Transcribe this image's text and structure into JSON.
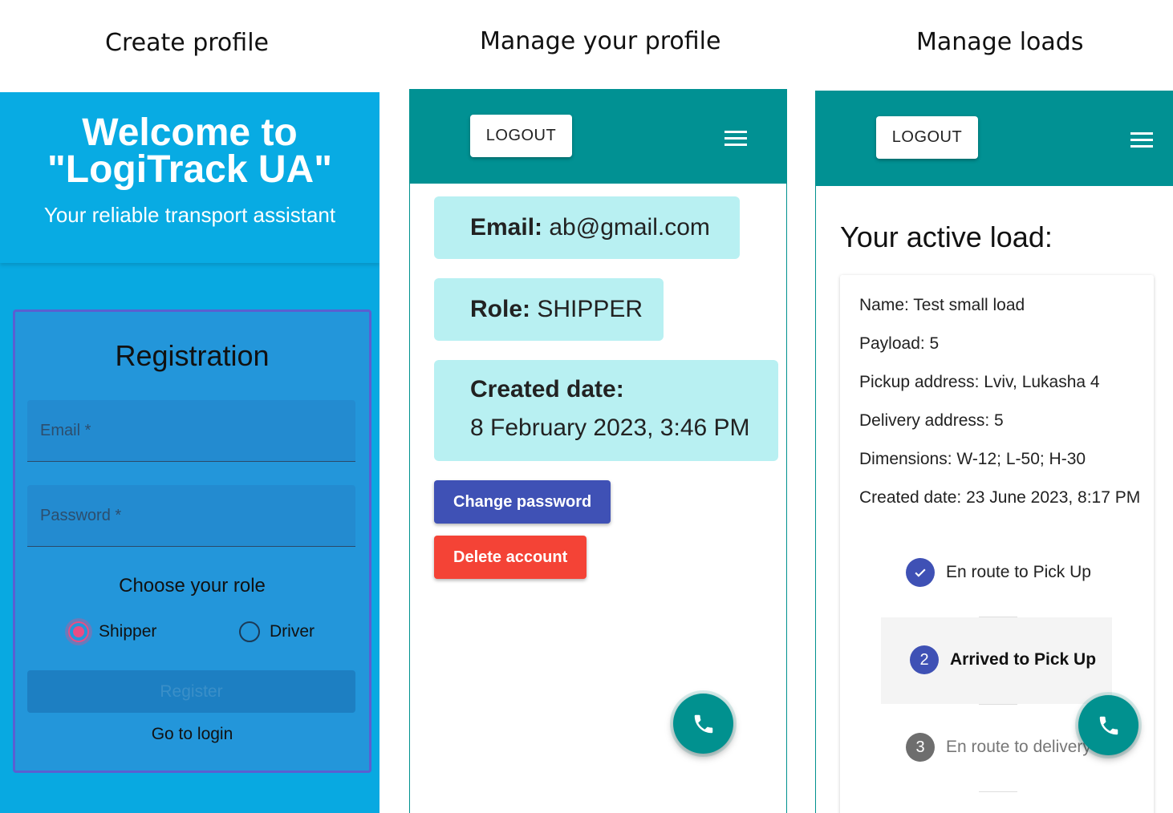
{
  "captions": {
    "create": "Create profile",
    "manage": "Manage your profile",
    "loads": "Manage loads"
  },
  "register_screen": {
    "welcome_line1": "Welcome to",
    "welcome_line2": "\"LogiTrack UA\"",
    "subtitle": "Your reliable transport assistant",
    "form_title": "Registration",
    "email_placeholder": "Email *",
    "password_placeholder": "Password *",
    "role_title": "Choose your role",
    "roles": [
      {
        "label": "Shipper",
        "selected": true
      },
      {
        "label": "Driver",
        "selected": false
      }
    ],
    "register_button": "Register",
    "login_link": "Go to login"
  },
  "profile_screen": {
    "logout": "LOGOUT",
    "email_label": "Email:",
    "email_value": "ab@gmail.com",
    "role_label": "Role:",
    "role_value": "SHIPPER",
    "created_label": "Created date:",
    "created_value": "8 February 2023, 3:46 PM",
    "change_password": "Change password",
    "delete_account": "Delete account"
  },
  "loads_screen": {
    "logout": "LOGOUT",
    "title": "Your active load:",
    "rows": [
      "Name: Test small load",
      "Payload: 5",
      "Pickup address: Lviv, Lukasha 4",
      "Delivery address: 5",
      "Dimensions: W-12; L-50; H-30",
      "Created date: 23 June 2023, 8:17 PM"
    ],
    "steps": [
      {
        "label": "En route to Pick Up",
        "status": "done",
        "num": ""
      },
      {
        "label": "Arrived to Pick Up",
        "status": "active",
        "num": "2"
      },
      {
        "label": "En route to delivery",
        "status": "pending",
        "num": "3"
      }
    ]
  },
  "colors": {
    "hero_blue": "#08abe3",
    "teal": "#019193",
    "info_cyan": "#b8f0f2",
    "indigo": "#3f51b5",
    "red": "#f44336",
    "pink": "#e94d84"
  },
  "icons": [
    "menu-icon",
    "phone-icon",
    "check-icon"
  ]
}
